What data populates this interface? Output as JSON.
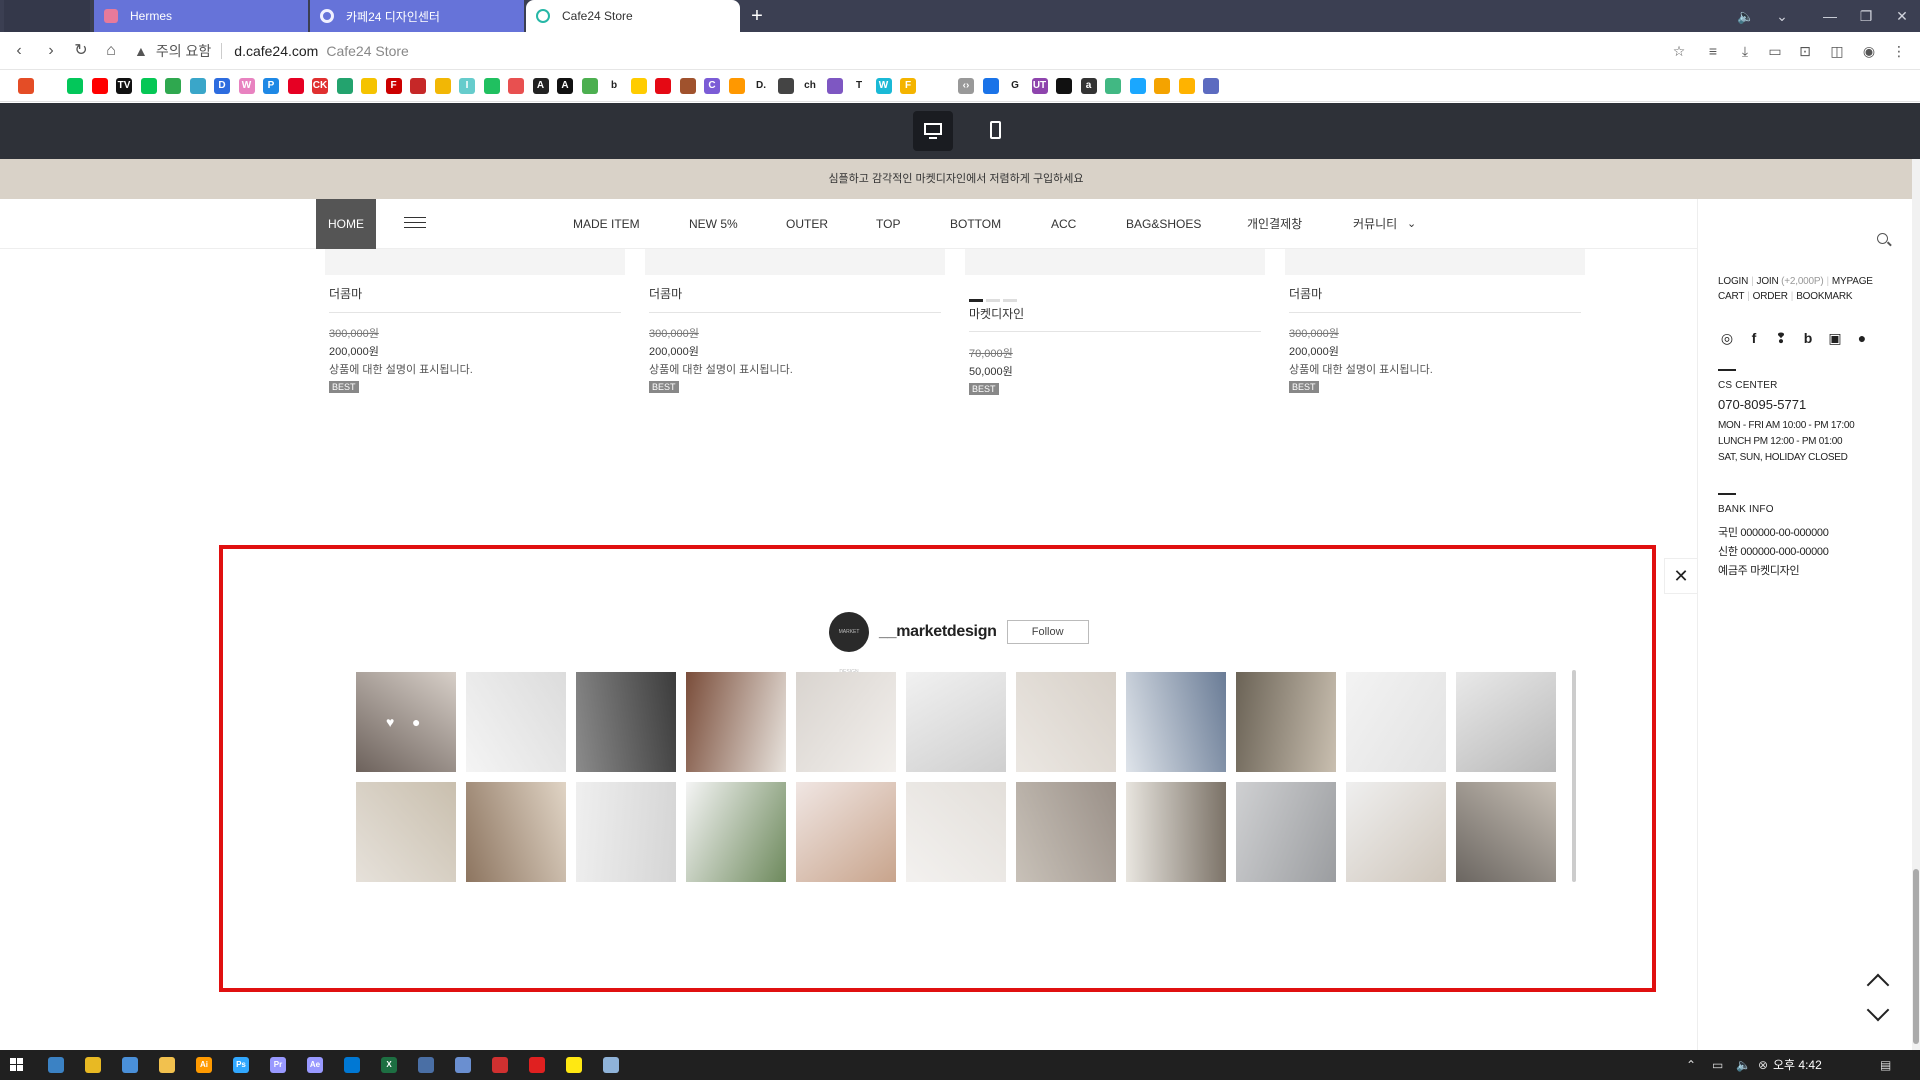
{
  "browser": {
    "tabs": [
      {
        "label": "Hermes"
      },
      {
        "label": "카페24 디자인센터"
      },
      {
        "label": "Cafe24 Store"
      }
    ],
    "new_tab": "+",
    "omnibox": {
      "security_warning": "주의 요함",
      "domain": "d.cafe24.com",
      "page_title": "Cafe24 Store"
    },
    "bookmark_icons": [
      "html5-icon",
      "google-icon",
      "naver-icon",
      "youtube-icon",
      "tv-icon",
      "line-icon",
      "px-icon",
      "d-icon",
      "bird-icon",
      "w-icon",
      "p-icon",
      "pinterest-icon",
      "ck-icon",
      "v-icon",
      "lemon-icon",
      "b-icon",
      "f-icon",
      "chick-icon",
      "i-icon",
      "blog-icon",
      "8-icon",
      "a-icon",
      "a2-icon",
      "leaf-icon",
      "b2-icon",
      "pinwheel-icon",
      "netflix-icon",
      "bear-icon",
      "c-icon",
      "bars-icon",
      "d2-icon",
      "owl-icon",
      "ch-icon",
      "eye-icon",
      "t-icon",
      "w2-icon",
      "f2-icon",
      "code-icon",
      "flag-icon",
      "g-icon",
      "ut-icon",
      "diamond-icon",
      "a3-icon",
      "vue-icon",
      "s-icon",
      "pinwheel2-icon",
      "sparkle-icon",
      "tp-icon"
    ],
    "bookmark_texts": {
      "ch": "ch",
      "d": "D.",
      "b": "b",
      "g": "G",
      "t": "T",
      "f": "F",
      "n": "N",
      "px": "px",
      "w": "W",
      "p": "P",
      "ck": "CK"
    }
  },
  "site": {
    "notice": "심플하고 감각적인 마켓디자인에서 저렴하게 구입하세요",
    "nav": {
      "home": "HOME",
      "items": [
        "MADE ITEM",
        "NEW 5%",
        "OUTER",
        "TOP",
        "BOTTOM",
        "ACC",
        "BAG&SHOES",
        "개인결제창",
        "커뮤니티"
      ]
    },
    "products": [
      {
        "name": "더콤마",
        "old_price": "300,000원",
        "price": "200,000원",
        "desc": "상품에 대한 설명이 표시됩니다.",
        "badge": "BEST"
      },
      {
        "name": "더콤마",
        "old_price": "300,000원",
        "price": "200,000원",
        "desc": "상품에 대한 설명이 표시됩니다.",
        "badge": "BEST"
      },
      {
        "name": "마켓디자인",
        "old_price": "70,000원",
        "price": "50,000원",
        "desc": "",
        "badge": "BEST"
      },
      {
        "name": "더콤마",
        "old_price": "300,000원",
        "price": "200,000원",
        "desc": "상품에 대한 설명이 표시됩니다.",
        "badge": "BEST"
      }
    ],
    "instagram": {
      "avatar_text": "MARKET DESIGN",
      "username": "__marketdesign",
      "follow_label": "Follow",
      "photos": [
        "tray-glasses",
        "pencil",
        "bed-book",
        "magazine-coffee",
        "white-bed",
        "kettle",
        "linen",
        "oil-bottle",
        "candle-lamp",
        "wall-hanger",
        "glass-vase",
        "scissors-pot",
        "desk-items",
        "white-fabric",
        "wreath",
        "macrame",
        "white-book",
        "notebook-glasses",
        "ladder-towels",
        "light-switch",
        "plate-table",
        "dried-flowers"
      ]
    },
    "quick": {
      "links_row1": {
        "login": "LOGIN",
        "join": "JOIN",
        "join_bonus": "(+2,000P)",
        "mypage": "MYPAGE"
      },
      "links_row2": {
        "cart": "CART",
        "order": "ORDER",
        "bookmark": "BOOKMARK"
      },
      "sns": [
        "instagram-icon",
        "facebook-icon",
        "kakaostory-icon",
        "blog-icon",
        "talk-icon",
        "kakaotalk-icon"
      ],
      "cs_label": "CS CENTER",
      "phone": "070-8095-5771",
      "hours": [
        "MON - FRI    AM 10:00 - PM 17:00",
        "LUNCH    PM 12:00 - PM 01:00",
        "SAT, SUN, HOLIDAY CLOSED"
      ],
      "bank_label": "BANK INFO",
      "banks": [
        "국민    000000-00-000000",
        "신한    000000-000-00000",
        "예금주    마켓디자인"
      ],
      "close": "✕"
    }
  },
  "taskbar": {
    "time": "오후 4:42"
  }
}
